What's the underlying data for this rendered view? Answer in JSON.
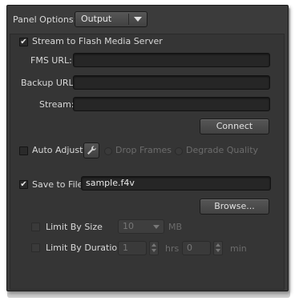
{
  "panel_options": {
    "label": "Panel Options:",
    "selected": "Output"
  },
  "stream": {
    "checkbox_label": "Stream to Flash Media Server",
    "checked": true,
    "fms_url_label": "FMS URL:",
    "fms_url_value": "",
    "backup_url_label": "Backup URL:",
    "backup_url_value": "",
    "stream_label": "Stream:",
    "stream_value": "",
    "connect_label": "Connect"
  },
  "auto_adjust": {
    "label": "Auto Adjust",
    "checked": false,
    "icon": "wrench-icon",
    "drop_frames_label": "Drop Frames",
    "degrade_quality_label": "Degrade Quality"
  },
  "save": {
    "checkbox_label": "Save to File",
    "checked": true,
    "filename": "sample.f4v",
    "browse_label": "Browse...",
    "limit_size_label": "Limit By Size",
    "limit_size_value": "10",
    "limit_size_unit": "MB",
    "limit_duration_label": "Limit By Duration",
    "hours_value": "1",
    "hours_unit": "hrs",
    "minutes_value": "0",
    "minutes_unit": "min"
  },
  "check_glyph": "✔"
}
